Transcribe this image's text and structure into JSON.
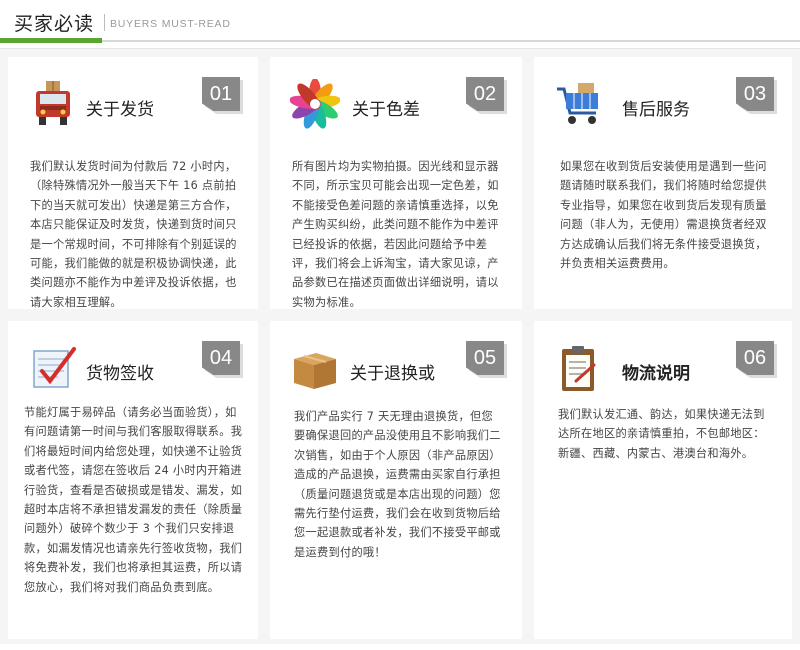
{
  "header": {
    "title": "买家必读",
    "subtitle": "BUYERS MUST-READ",
    "accent_color": "#5aa52f"
  },
  "cards": [
    {
      "icon": "delivery-truck-icon",
      "title": "关于发货",
      "number": "01",
      "text": "我们默认发货时间为付款后 72 小时内，（除特殊情况外一般当天下午 16 点前拍下的当天就可发出）快递是第三方合作，本店只能保证及时发货，快递到货时间只是一个常规时间，不可排除有个别延误的可能，我们能做的就是积极协调快递，此类问题亦不能作为中差评及投诉依据，也请大家相互理解。"
    },
    {
      "icon": "color-wheel-icon",
      "title": "关于色差",
      "number": "02",
      "text": "所有图片均为实物拍摄。因光线和显示器不同，所示宝贝可能会出现一定色差，如不能接受色差问题的亲请慎重选择，以免产生购买纠纷，此类问题不能作为中差评已经投诉的依据，若因此问题给予中差评，我们将会上诉淘宝，请大家见谅，产品参数已在描述页面做出详细说明，请以实物为标准。"
    },
    {
      "icon": "shopping-cart-icon",
      "title": "售后服务",
      "number": "03",
      "text": "如果您在收到货后安装使用是遇到一些问题请随时联系我们，我们将随时给您提供专业指导，如果您在收到货后发现有质量问题（非人为，无使用）需退换货者经双方达成确认后我们将无条件接受退换货，并负责相关运费费用。"
    },
    {
      "icon": "checklist-icon",
      "title": "货物签收",
      "number": "04",
      "text": "节能灯属于易碎品（请务必当面验货），如有问题请第一时间与我们客服取得联系。我们将最短时间内给您处理，如快递不让验货或者代签，请您在签收后 24 小时内开箱进行验货，查看是否破损或是错发、漏发，如超时本店将不承担错发漏发的责任（除质量问题外）破碎个数少于 3 个我们只安排退款，如漏发情况也请亲先行签收货物，我们将免费补发，我们也将承担其运费，所以请您放心，我们将对我们商品负责到底。"
    },
    {
      "icon": "cardboard-box-icon",
      "title": "关于退换或",
      "number": "05",
      "text": "我们产品实行 7 天无理由退换货，但您要确保退回的产品没使用且不影响我们二次销售，如由于个人原因（非产品原因）造成的产品退换，运费需由买家自行承担（质量问题退货或是本店出现的问题）您需先行垫付运费，我们会在收到货物后给您一起退款或者补发，我们不接受平邮或是运费到付的哦！"
    },
    {
      "icon": "clipboard-icon",
      "title": "物流说明",
      "number": "06",
      "text": "我们默认发汇通、韵达，如果快递无法到达所在地区的亲请慎重拍，不包邮地区：新疆、西藏、内蒙古、港澳台和海外。"
    }
  ]
}
